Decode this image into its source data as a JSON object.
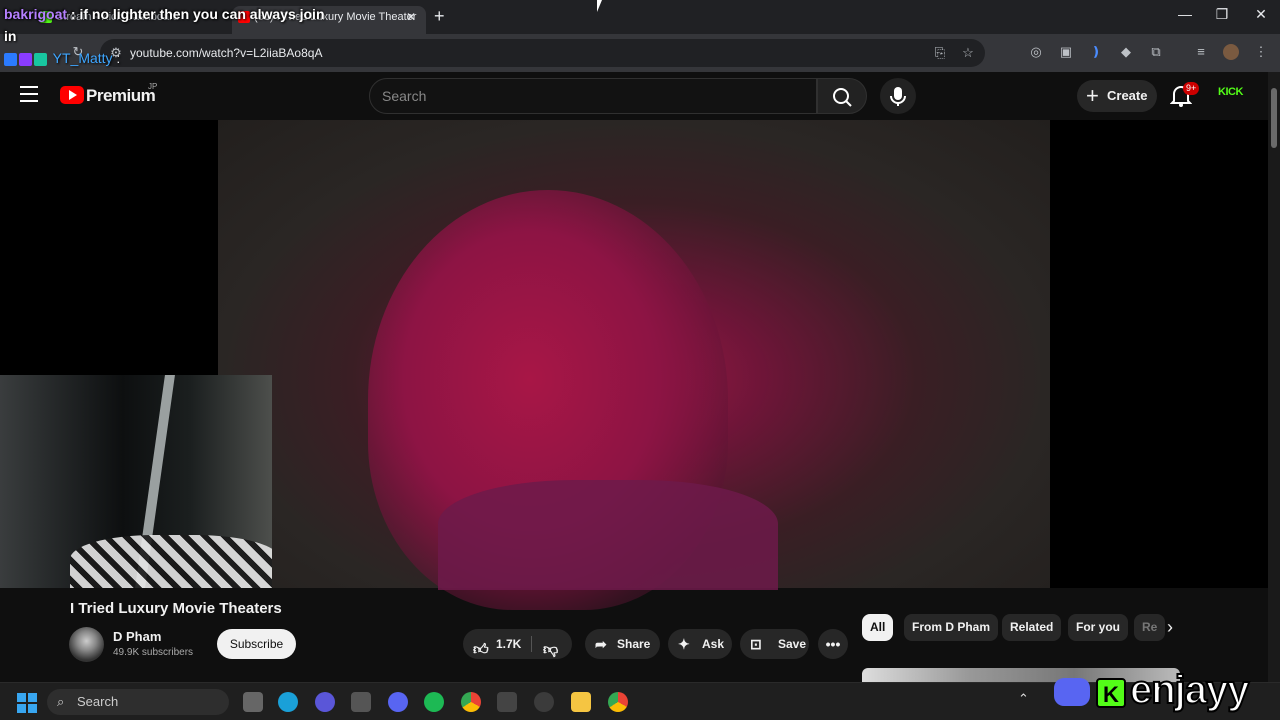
{
  "browser": {
    "tabs": [
      {
        "label": "Stream - Kick Dashboard",
        "active": false
      },
      {
        "label": "(61) I Tried Luxury Movie Theater",
        "active": true
      }
    ],
    "new_tab": "+",
    "url": "youtube.com/watch?v=L2iiaBAo8qA"
  },
  "chat": [
    {
      "user": "bakrigoat",
      "message": "if no lighter then you can always join in"
    },
    {
      "user": "YT_Matty",
      "message": ""
    }
  ],
  "youtube": {
    "logo_text": "Premium",
    "region": "JP",
    "search_placeholder": "Search",
    "create_label": "Create",
    "notifications": "9+",
    "kick_logo": "KICK"
  },
  "video": {
    "title": "I Tried Luxury Movie Theaters",
    "channel": "D Pham",
    "subscribers": "49.9K subscribers",
    "subscribe_label": "Subscribe",
    "likes": "1.7K",
    "share_label": "Share",
    "ask_label": "Ask",
    "save_label": "Save"
  },
  "chips": [
    "All",
    "From D Pham",
    "Related",
    "For you",
    "Re"
  ],
  "taskbar": {
    "search_label": "Search"
  },
  "overlay": {
    "brand_text": "enjayy"
  },
  "colors": {
    "youtube_red": "#ff0000",
    "kick_green": "#53fc18",
    "discord": "#5865f2"
  }
}
